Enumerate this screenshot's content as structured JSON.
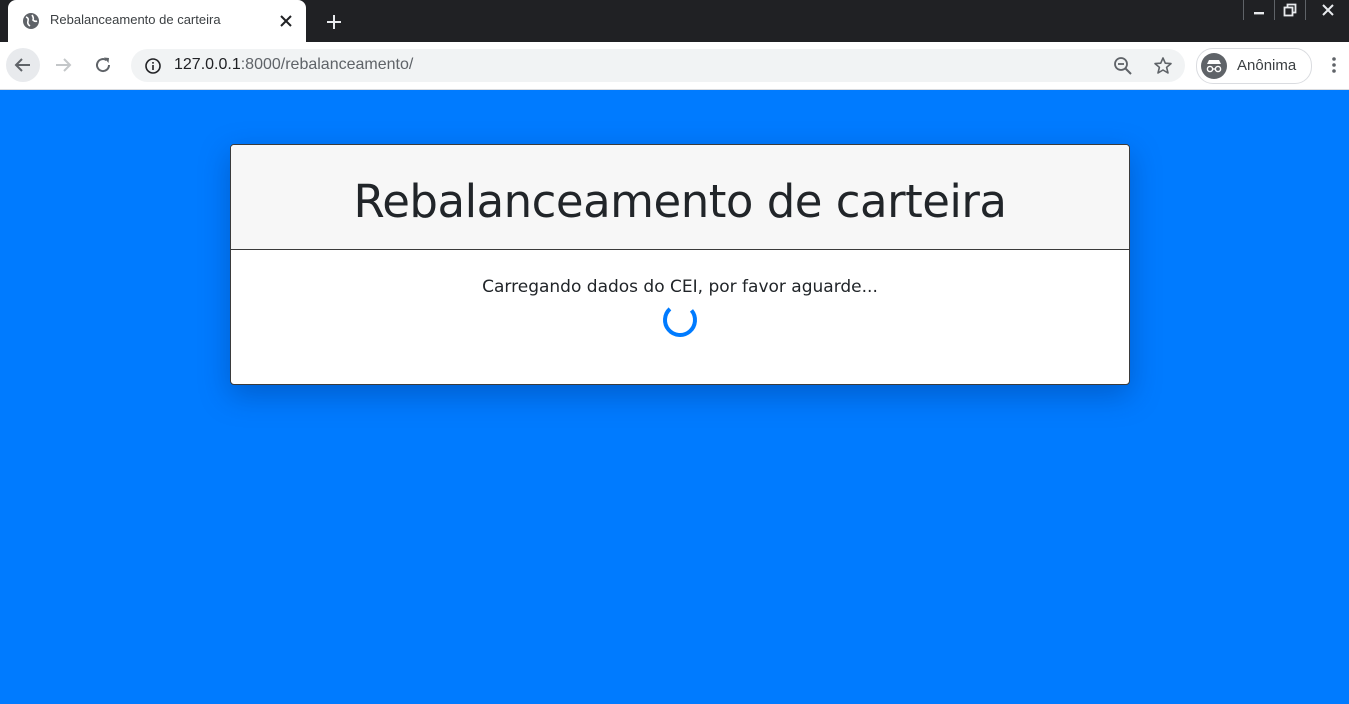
{
  "browser": {
    "tab": {
      "title": "Rebalanceamento de carteira"
    },
    "address": {
      "host": "127.0.0.1",
      "rest": ":8000/rebalanceamento/"
    },
    "profile": {
      "label": "Anônima"
    }
  },
  "page": {
    "title": "Rebalanceamento de carteira",
    "loading_message": "Carregando dados do CEI, por favor aguarde..."
  },
  "colors": {
    "page_background": "#007bff",
    "spinner": "#007bff",
    "tabstrip": "#202124"
  },
  "icons": {
    "favicon": "globe-icon",
    "tab_close": "close-icon",
    "new_tab": "plus-icon",
    "back": "arrow-left-icon",
    "forward": "arrow-right-icon",
    "reload": "reload-icon",
    "site_info": "info-icon",
    "zoom": "zoom-out-icon",
    "bookmark": "star-icon",
    "profile": "incognito-icon",
    "menu": "more-vert-icon"
  }
}
